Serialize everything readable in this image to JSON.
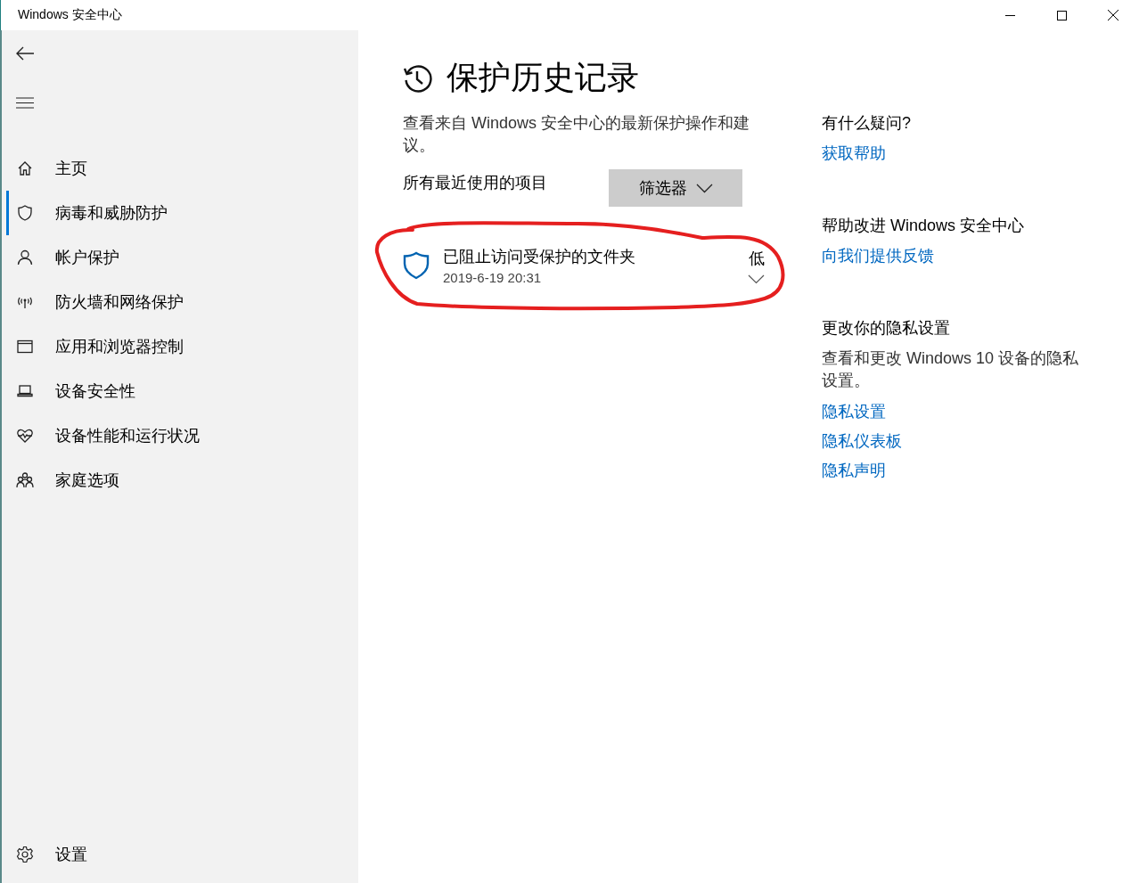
{
  "window": {
    "title": "Windows 安全中心"
  },
  "sidebar": {
    "items": [
      {
        "label": "主页",
        "selected": false
      },
      {
        "label": "病毒和威胁防护",
        "selected": true
      },
      {
        "label": "帐户保护",
        "selected": false
      },
      {
        "label": "防火墙和网络保护",
        "selected": false
      },
      {
        "label": "应用和浏览器控制",
        "selected": false
      },
      {
        "label": "设备安全性",
        "selected": false
      },
      {
        "label": "设备性能和运行状况",
        "selected": false
      },
      {
        "label": "家庭选项",
        "selected": false
      }
    ],
    "settings": "设置"
  },
  "page": {
    "title": "保护历史记录",
    "description": "查看来自 Windows 安全中心的最新保护操作和建议。",
    "section_label": "所有最近使用的项目",
    "filter_button": "筛选器",
    "history": [
      {
        "title": "已阻止访问受保护的文件夹",
        "date": "2019-6-19 20:31",
        "severity": "低",
        "expanded": false
      }
    ]
  },
  "aside": [
    {
      "heading": "有什么疑问?",
      "links": [
        "获取帮助"
      ]
    },
    {
      "heading": "帮助改进 Windows 安全中心",
      "links": [
        "向我们提供反馈"
      ]
    },
    {
      "heading": "更改你的隐私设置",
      "description": "查看和更改 Windows 10 设备的隐私设置。",
      "links": [
        "隐私设置",
        "隐私仪表板",
        "隐私声明"
      ]
    }
  ]
}
